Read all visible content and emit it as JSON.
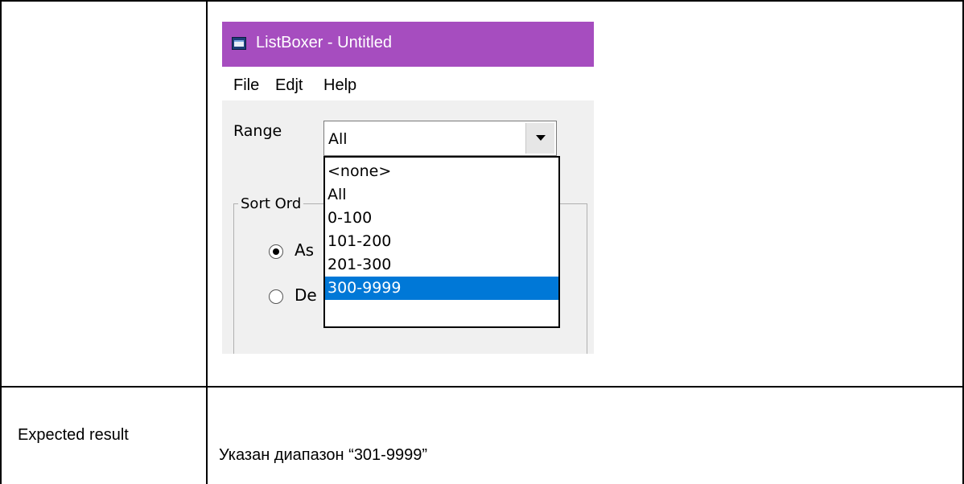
{
  "app": {
    "title": "ListBoxer - Untitled",
    "titlebar_color": "#a64dbf",
    "menu": [
      {
        "label": "File"
      },
      {
        "label": "Edjt"
      },
      {
        "label": "Help"
      }
    ],
    "range_label": "Range",
    "range_value": "All",
    "sort_group_caption": "Sort Ord",
    "radio_ascending": "As",
    "radio_descending": "De",
    "dropdown_options": [
      "<none>",
      "All",
      "0-100",
      "101-200",
      "201-300",
      "300-9999"
    ],
    "selected_option": "300-9999",
    "selection_color": "#0078d7"
  },
  "document": {
    "row_label": "Expected result",
    "row_value": "Указан диапазон “301-9999”"
  }
}
